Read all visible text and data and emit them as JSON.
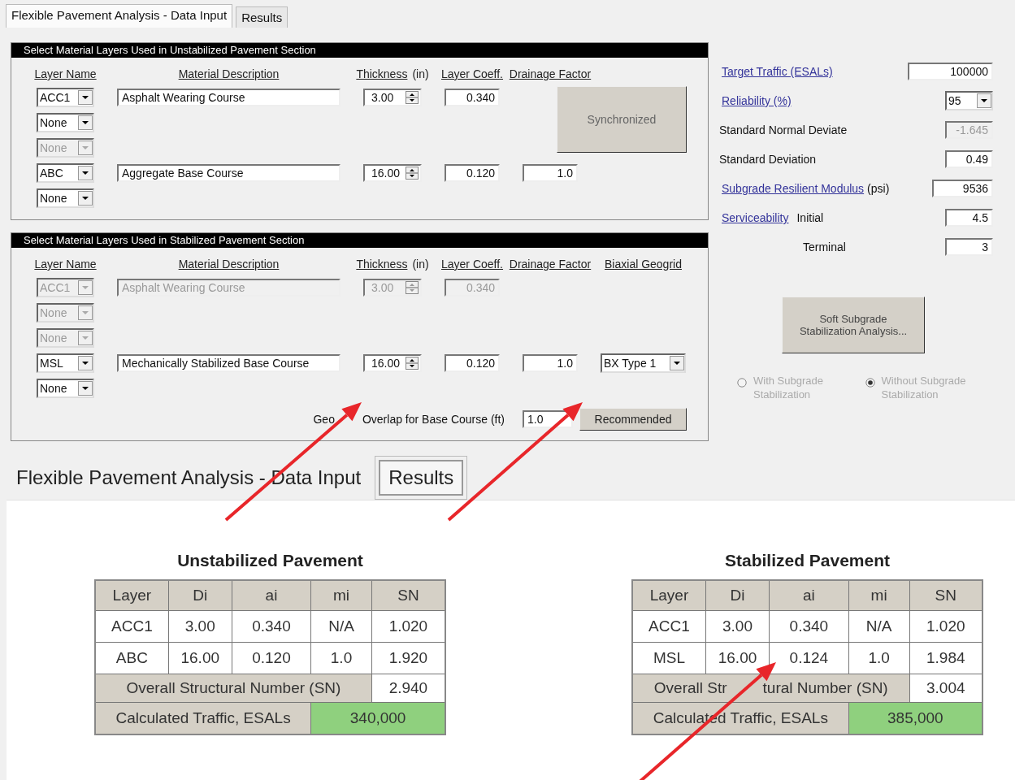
{
  "top_tabs": [
    {
      "label": "Flexible Pavement Analysis - Data Input",
      "selected": true
    },
    {
      "label": "Results",
      "selected": false
    }
  ],
  "sections": [
    {
      "title": "Select Material Layers Used in Unstabilized Pavement Section",
      "headers": {
        "layer": "Layer Name",
        "description": "Material Description",
        "thickness": "Thickness",
        "thickness_unit": "(in)",
        "coeff": "Layer Coeff.",
        "drainage": "Drainage Factor"
      },
      "rows": [
        {
          "layer": "ACC1",
          "disabled": false,
          "description": "Asphalt Wearing Course",
          "thickness": "3.00",
          "coeff": "0.340"
        },
        {
          "layer": "None",
          "disabled": false
        },
        {
          "layer": "None",
          "disabled": true
        },
        {
          "layer": "ABC",
          "disabled": false,
          "description": "Aggregate Base Course",
          "thickness": "16.00",
          "coeff": "0.120",
          "drainage": "1.0"
        },
        {
          "layer": "None",
          "disabled": false
        }
      ],
      "sync_button": "Synchronized"
    },
    {
      "title": "Select Material Layers Used in Stabilized Pavement Section",
      "headers": {
        "layer": "Layer Name",
        "description": "Material Description",
        "thickness": "Thickness",
        "thickness_unit": "(in)",
        "coeff": "Layer Coeff.",
        "drainage": "Drainage Factor",
        "geogrid": "Biaxial Geogrid"
      },
      "rows": [
        {
          "layer": "ACC1",
          "disabled": true,
          "description": "Asphalt Wearing Course",
          "thickness": "3.00",
          "coeff": "0.340"
        },
        {
          "layer": "None",
          "disabled": true
        },
        {
          "layer": "None",
          "disabled": true
        },
        {
          "layer": "MSL",
          "disabled": false,
          "description": "Mechanically Stabilized Base Course",
          "thickness": "16.00",
          "coeff": "0.120",
          "drainage": "1.0",
          "geogrid": "BX Type 1"
        },
        {
          "layer": "None",
          "disabled": false
        }
      ],
      "overlap": {
        "label": [
          "Geo",
          "Overlap for Base Course (ft)"
        ],
        "value": "1.0",
        "button": "Recommended"
      }
    }
  ],
  "parameters": [
    {
      "kind": "link",
      "label": "Target Traffic (ESALs)",
      "dropdown": false,
      "value": "100000",
      "disabled": false
    },
    {
      "kind": "link",
      "label": "Reliability (%)",
      "dropdown": true,
      "value": "95",
      "disabled": false
    },
    {
      "kind": "plain",
      "label": "Standard Normal Deviate",
      "dropdown": false,
      "value": "-1.645",
      "disabled": true
    },
    {
      "kind": "plain",
      "label": "Standard Deviation",
      "dropdown": false,
      "value": "0.49",
      "disabled": false
    },
    {
      "kind": "link",
      "label": "Subgrade Resilient Modulus",
      "unit": "(psi)",
      "dropdown": false,
      "value": "9536",
      "disabled": false
    },
    {
      "kind": "link",
      "label": "Serviceability",
      "sublabel": "Initial",
      "dropdown": false,
      "value": "4.5",
      "disabled": false
    },
    {
      "kind": "sub",
      "label": "Terminal",
      "dropdown": false,
      "value": "3",
      "disabled": false
    }
  ],
  "analysis_button": "Soft Subgrade Stabilization Analysis...",
  "radios": [
    {
      "label": "With Subgrade Stabilization",
      "selected": false,
      "disabled": true
    },
    {
      "label": "Without Subgrade Stabilization",
      "selected": true,
      "disabled": true
    }
  ],
  "bottom_tabs": [
    {
      "label": "Flexible Pavement Analysis - Data Input",
      "selected": false
    },
    {
      "label": "Results",
      "selected": true
    }
  ],
  "results": [
    {
      "title": "Unstabilized Pavement",
      "columns": [
        "Layer",
        "Di",
        "ai",
        "mi",
        "SN"
      ],
      "rows": [
        [
          "ACC1",
          "3.00",
          "0.340",
          "N/A",
          "1.020"
        ],
        [
          "ABC",
          "16.00",
          "0.120",
          "1.0",
          "1.920"
        ]
      ],
      "sn_label": [
        "Overall Structural Number (SN)"
      ],
      "sn": "2.940",
      "traffic_label": "Calculated Traffic, ESALs",
      "traffic": "340,000"
    },
    {
      "title": "Stabilized Pavement",
      "columns": [
        "Layer",
        "Di",
        "ai",
        "mi",
        "SN"
      ],
      "rows": [
        [
          "ACC1",
          "3.00",
          "0.340",
          "N/A",
          "1.020"
        ],
        [
          "MSL",
          "16.00",
          "0.124",
          "1.0",
          "1.984"
        ]
      ],
      "sn_label": [
        "Overall Str",
        "tural Number (SN)"
      ],
      "sn": "3.004",
      "traffic_label": "Calculated Traffic, ESALs",
      "traffic": "385,000"
    }
  ]
}
